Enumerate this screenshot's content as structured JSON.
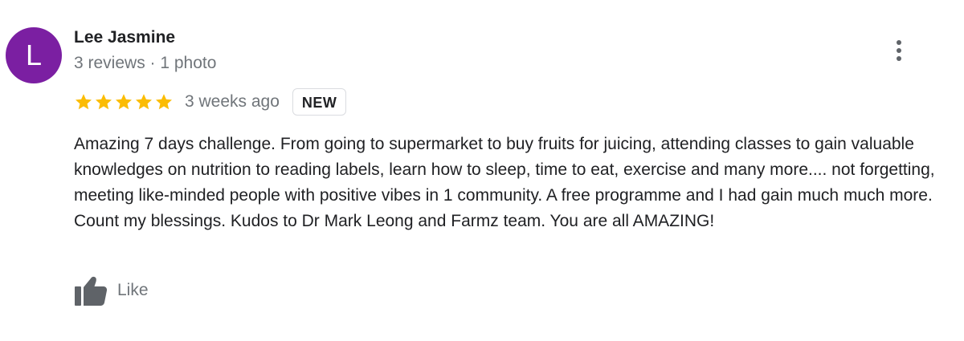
{
  "review": {
    "author": {
      "initial": "L",
      "name": "Lee Jasmine",
      "meta": "3 reviews · 1 photo",
      "avatar_color": "#7b1fa2"
    },
    "more_icon": "more-vert-icon",
    "rating": {
      "stars": 5,
      "max_stars": 5,
      "star_color": "#fbbc04",
      "star_icon": "star-icon"
    },
    "date": "3 weeks ago",
    "badge": "NEW",
    "text": "Amazing 7 days challenge. From going to supermarket to buy fruits for juicing, attending classes to gain valuable knowledges on nutrition to reading labels, learn how to sleep, time to eat, exercise and many more.... not forgetting, meeting like-minded people with positive vibes in 1 community. A free programme and I had gain much much more. Count my blessings. Kudos to Dr Mark Leong and Farmz team. You are all AMAZING!",
    "like": {
      "label": "Like",
      "icon": "thumbs-up-icon",
      "icon_color": "#5f6368"
    }
  }
}
